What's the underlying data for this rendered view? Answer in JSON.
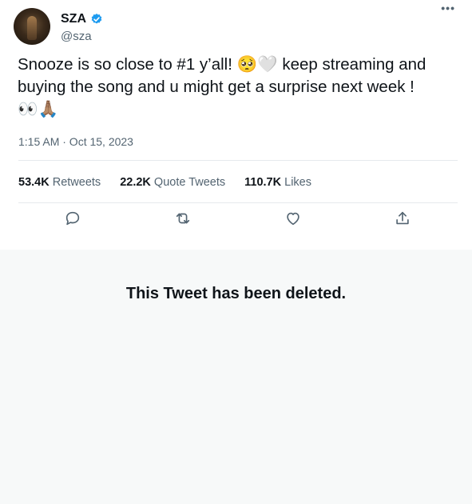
{
  "user": {
    "name": "SZA",
    "handle": "@sza"
  },
  "tweet": {
    "text": "Snooze is so close to #1 y’all! 🥺🤍 keep streaming and\nbuying the song and u might get a surprise next week !\n👀🙏🏽",
    "timestamp": "1:15 AM · Oct 15, 2023"
  },
  "stats": {
    "retweets_count": "53.4K",
    "retweets_label": "Retweets",
    "quotes_count": "22.2K",
    "quotes_label": "Quote Tweets",
    "likes_count": "110.7K",
    "likes_label": "Likes"
  },
  "icons": [
    "more-icon",
    "verified-icon",
    "reply-icon",
    "retweet-icon",
    "like-icon",
    "share-icon"
  ],
  "colors": {
    "verified": "#1d9bf0",
    "secondary_text": "#536471",
    "deleted_background": "#f7f9f9"
  },
  "deleted_notice": "This Tweet has been deleted."
}
